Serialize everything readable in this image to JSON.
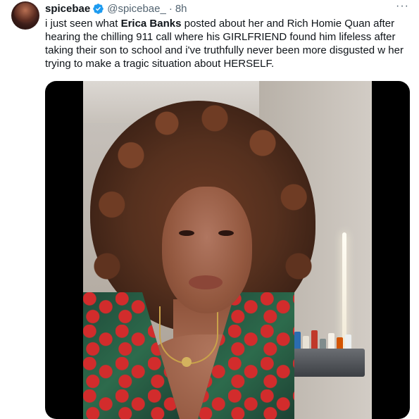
{
  "author": {
    "display_name": "spicebae",
    "handle": "@spicebae_",
    "separator": "·",
    "time": "8h",
    "verified": true,
    "verified_color": "#1d9bf0"
  },
  "more_label": "···",
  "tweet": {
    "text_before": "i just seen what ",
    "text_bold": "Erica Banks",
    "text_after": " posted about her and Rich Homie Quan after hearing the chilling 911 call where his GIRLFRIEND found him lifeless after taking their son to school and i've truthfully never been more disgusted w her trying to make a tragic situation about HERSELF."
  },
  "media": {
    "type": "video-still",
    "icon": "video-thumbnail"
  },
  "colors": {
    "text": "#0f1419",
    "secondary": "#536471",
    "accent": "#1d9bf0"
  }
}
